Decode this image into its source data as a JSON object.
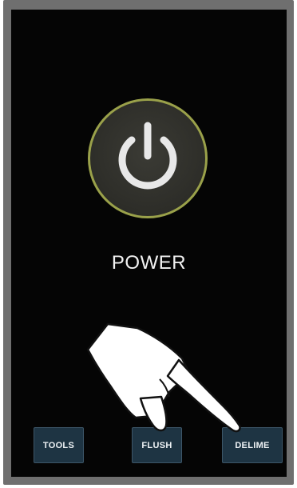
{
  "screen": {
    "background": "#050505",
    "accent_ring_color": "#9aa14a"
  },
  "power": {
    "icon": "power-icon",
    "label": "POWER"
  },
  "bottom_buttons": [
    {
      "label": "TOOLS"
    },
    {
      "label": "FLUSH"
    },
    {
      "label": "DELIME"
    }
  ],
  "overlay": {
    "icon": "pointing-hand-icon"
  }
}
